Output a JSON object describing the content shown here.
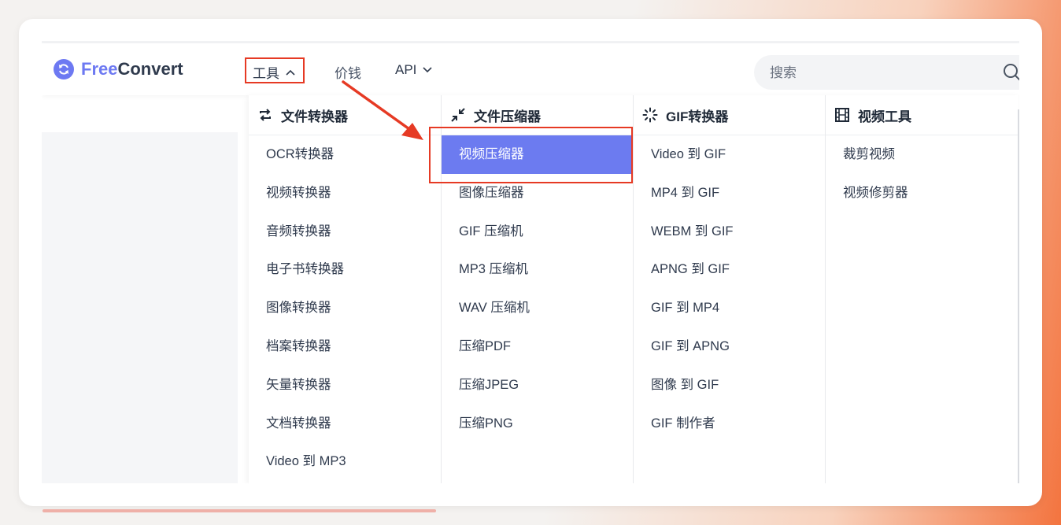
{
  "logo": {
    "brand_part1": "Free",
    "brand_part2": "Convert"
  },
  "nav": {
    "tools": "工具",
    "price": "价钱",
    "api": "API"
  },
  "search": {
    "placeholder": "搜索"
  },
  "dropdown": {
    "columns": [
      {
        "title": "文件转换器",
        "icon": "convert-arrows-icon",
        "items": [
          "OCR转换器",
          "视频转换器",
          "音频转换器",
          "电子书转换器",
          "图像转换器",
          "档案转换器",
          "矢量转换器",
          "文档转换器",
          "Video 到 MP3"
        ]
      },
      {
        "title": "文件压缩器",
        "icon": "compress-arrows-icon",
        "items": [
          "视频压缩器",
          "图像压缩器",
          "GIF 压缩机",
          "MP3 压缩机",
          "WAV 压缩机",
          "压缩PDF",
          "压缩JPEG",
          "压缩PNG"
        ]
      },
      {
        "title": "GIF转换器",
        "icon": "loader-icon",
        "items": [
          "Video 到 GIF",
          "MP4 到 GIF",
          "WEBM 到 GIF",
          "APNG 到 GIF",
          "GIF 到 MP4",
          "GIF 到 APNG",
          "图像 到 GIF",
          "GIF 制作者"
        ]
      },
      {
        "title": "视频工具",
        "icon": "film-icon",
        "items": [
          "裁剪视频",
          "视频修剪器"
        ]
      }
    ]
  },
  "colors": {
    "accent": "#6c7bf0",
    "annotation_red": "#e63a24",
    "text": "#2f3a4d"
  }
}
